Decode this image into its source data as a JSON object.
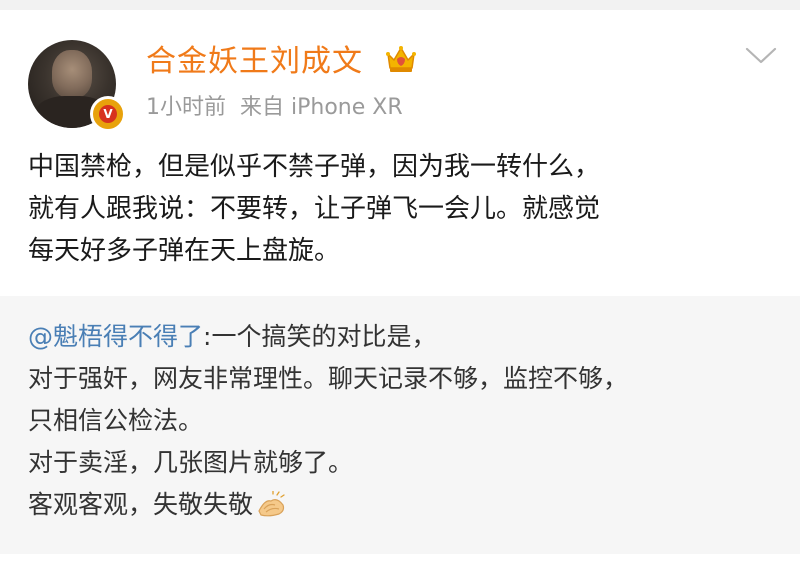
{
  "post": {
    "username": "合金妖王刘成文",
    "timestamp": "1小时前",
    "source": "来自 iPhone XR",
    "content_lines": [
      "中国禁枪，但是似乎不禁子弹，因为我一转什么，",
      "就有人跟我说：不要转，让子弹飞一会儿。就感觉",
      "每天好多子弹在天上盘旋。"
    ]
  },
  "repost": {
    "mention": "@魁梧得不得了",
    "lines": [
      ":一个搞笑的对比是，",
      "对于强奸，网友非常理性。聊天记录不够，监控不够，",
      "只相信公检法。",
      "对于卖淫，几张图片就够了。",
      "客观客观，失敬失敬"
    ]
  },
  "colors": {
    "username": "#f07a19",
    "mention": "#4a7fb5",
    "meta": "#9a9a9a",
    "repost_bg": "#f6f6f6"
  },
  "icons": {
    "crown": "crown-icon",
    "verified": "verified-badge-icon",
    "chevron": "chevron-down-icon",
    "emoji": "clapping-hands-icon"
  }
}
